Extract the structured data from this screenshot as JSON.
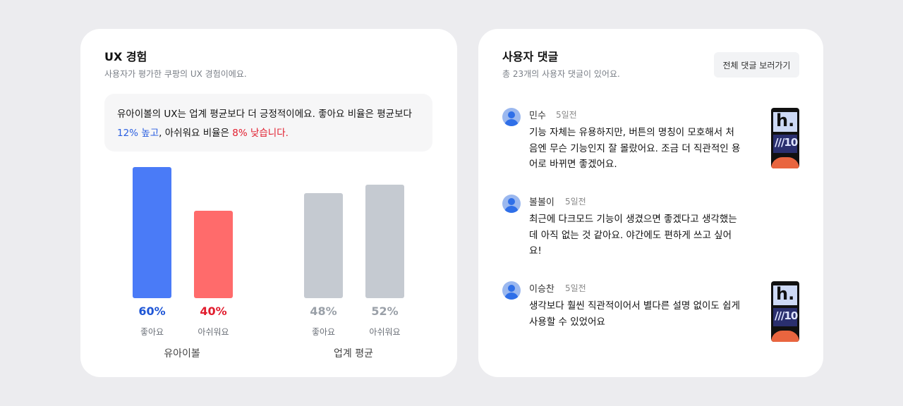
{
  "ux": {
    "title": "UX 경험",
    "subtitle": "사용자가 평가한 쿠팡의 UX 경험이에요.",
    "summary": {
      "part1": "유아이볼의 UX는 업계 평균보다 더 긍정적이에요. 좋아요 비율은 평균보다 ",
      "highlight_good": "12% 높고",
      "part2": ", 아쉬워요 비율은 ",
      "highlight_bad": "8% 낮습니다."
    }
  },
  "chart_data": {
    "type": "bar",
    "groups": [
      {
        "name": "유아이볼",
        "bars": [
          {
            "label": "좋아요",
            "value": 60,
            "value_text": "60%",
            "color": "#4a7bf7",
            "text_color": "#1f56d6"
          },
          {
            "label": "아쉬워요",
            "value": 40,
            "value_text": "40%",
            "color": "#ff6b6b",
            "text_color": "#e11d2e"
          }
        ]
      },
      {
        "name": "업계 평균",
        "bars": [
          {
            "label": "좋아요",
            "value": 48,
            "value_text": "48%",
            "color": "#c5cad1",
            "text_color": "#9aa0a8"
          },
          {
            "label": "아쉬워요",
            "value": 52,
            "value_text": "52%",
            "color": "#c5cad1",
            "text_color": "#9aa0a8"
          }
        ]
      }
    ],
    "ylim": [
      0,
      60
    ]
  },
  "comments": {
    "title": "사용자 댓글",
    "subtitle": "총 23개의 사용자 댓글이 있어요.",
    "view_all_label": "전체 댓글 보러가기",
    "items": [
      {
        "name": "민수",
        "time": "5일전",
        "text": "기능 자체는 유용하지만, 버튼의 명칭이 모호해서 처음엔 무슨 기능인지 잘 몰랐어요. 조금 더 직관적인 용어로 바뀌면 좋겠어요.",
        "has_thumb": true,
        "thumb_letter": "h.",
        "thumb_text": "///10"
      },
      {
        "name": "볼볼이",
        "time": "5일전",
        "text": "최근에 다크모드 기능이 생겼으면 좋겠다고 생각했는데 아직 없는 것 같아요. 야간에도 편하게 쓰고 싶어요!",
        "has_thumb": false
      },
      {
        "name": "이승찬",
        "time": "5일전",
        "text": "생각보다 훨씬 직관적이어서 별다른 설명 없이도 쉽게 사용할 수 있었어요",
        "has_thumb": true,
        "thumb_letter": "h.",
        "thumb_text": "///10"
      }
    ]
  },
  "colors": {
    "page_bg": "#ececef",
    "card_bg": "#ffffff",
    "accent_blue": "#4a7bf7",
    "accent_red": "#ff6b6b",
    "neutral_bar": "#c5cad1"
  }
}
